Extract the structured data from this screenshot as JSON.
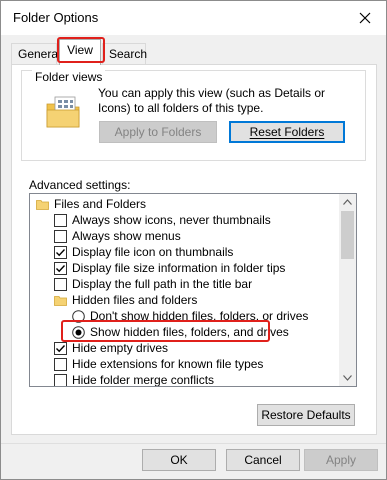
{
  "window": {
    "title": "Folder Options"
  },
  "tabs": [
    {
      "label": "General"
    },
    {
      "label": "View"
    },
    {
      "label": "Search"
    }
  ],
  "folder_views": {
    "legend": "Folder views",
    "description": "You can apply this view (such as Details or Icons) to all folders of this type.",
    "apply_button": "Apply to Folders",
    "reset_button": "Reset Folders",
    "reset_underline": "R"
  },
  "advanced": {
    "label": "Advanced settings:",
    "items": [
      {
        "type": "folder",
        "label": "Files and Folders"
      },
      {
        "type": "checkbox",
        "checked": false,
        "label": "Always show icons, never thumbnails"
      },
      {
        "type": "checkbox",
        "checked": false,
        "label": "Always show menus"
      },
      {
        "type": "checkbox",
        "checked": true,
        "label": "Display file icon on thumbnails"
      },
      {
        "type": "checkbox",
        "checked": true,
        "label": "Display file size information in folder tips"
      },
      {
        "type": "checkbox",
        "checked": false,
        "label": "Display the full path in the title bar"
      },
      {
        "type": "folder",
        "label": "Hidden files and folders"
      },
      {
        "type": "radio",
        "checked": false,
        "label": "Don't show hidden files, folders, or drives"
      },
      {
        "type": "radio",
        "checked": true,
        "label": "Show hidden files, folders, and drives"
      },
      {
        "type": "checkbox",
        "checked": true,
        "label": "Hide empty drives"
      },
      {
        "type": "checkbox",
        "checked": false,
        "label": "Hide extensions for known file types"
      },
      {
        "type": "checkbox",
        "checked": false,
        "label": "Hide folder merge conflicts"
      }
    ]
  },
  "buttons": {
    "restore": "Restore Defaults",
    "ok": "OK",
    "cancel": "Cancel",
    "apply": "Apply"
  },
  "colors": {
    "highlight": "#e0201b",
    "accent": "#0078d7",
    "folder": "#f5d273"
  },
  "icons": {
    "close": "close-icon",
    "folder_views": "folder-views-icon",
    "folder": "folder-icon"
  }
}
